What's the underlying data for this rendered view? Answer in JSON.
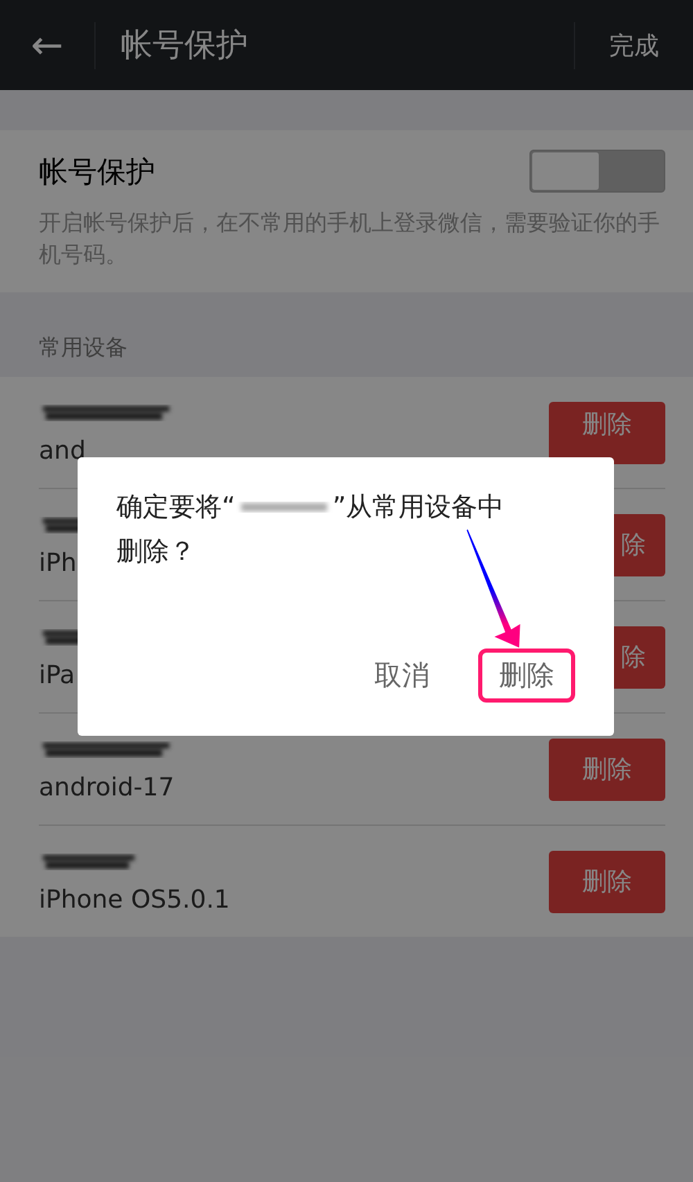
{
  "header": {
    "back_icon": "←",
    "title": "帐号保护",
    "action": "完成"
  },
  "protection": {
    "title": "帐号保护",
    "on": false,
    "description": "开启帐号保护后，在不常用的手机上登录微信，需要验证你的手机号码。"
  },
  "devices_section": {
    "title": "常用设备"
  },
  "devices": [
    {
      "subtitle": "and",
      "button": "删除"
    },
    {
      "subtitle": "iPh",
      "button": "除"
    },
    {
      "subtitle": "iPa",
      "button": "除"
    },
    {
      "subtitle": "android-17",
      "button": "删除"
    },
    {
      "subtitle": "iPhone OS5.0.1",
      "button": "删除"
    }
  ],
  "dialog": {
    "message_before": "确定要将“",
    "message_after": "”从常用设备中",
    "message_line2": "删除？",
    "buttons": [
      {
        "label": "取消",
        "highlighted": false
      },
      {
        "label": "删除",
        "highlighted": true
      }
    ]
  }
}
